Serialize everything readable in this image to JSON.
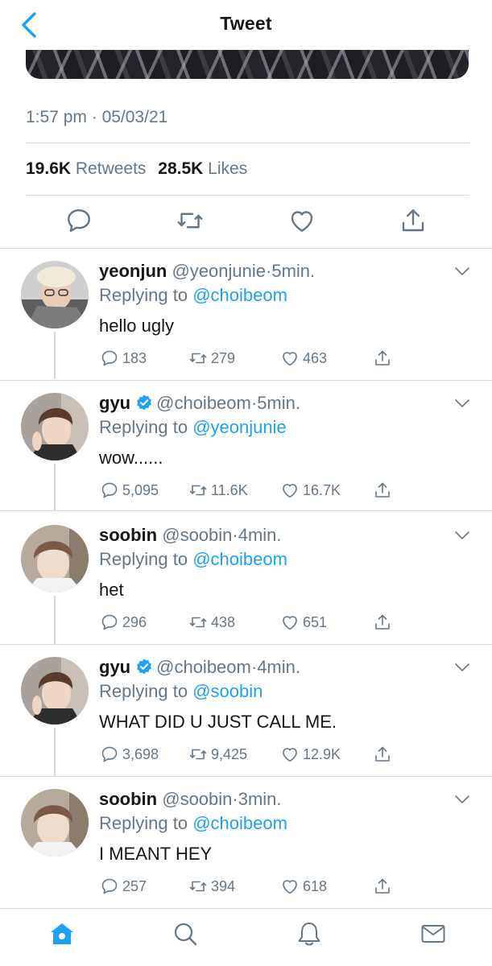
{
  "header": {
    "title": "Tweet"
  },
  "tweet": {
    "time": "1:57 pm",
    "date": "05/03/21",
    "retweets_count": "19.6K",
    "retweets_label": "Retweets",
    "likes_count": "28.5K",
    "likes_label": "Likes"
  },
  "colors": {
    "accent": "#1da1f2",
    "muted": "#657786",
    "text": "#14171a",
    "divider": "#d6dde2"
  },
  "replies": [
    {
      "name": "yeonjun",
      "handle": "@yeonjunie",
      "time": "5min.",
      "replying_prefix": "Replying to",
      "replying_to": "@choibeom",
      "text": "hello ugly",
      "replies": "183",
      "retweets": "279",
      "likes": "463",
      "verified": false
    },
    {
      "name": "gyu",
      "handle": "@choibeom",
      "time": "5min.",
      "replying_prefix": "Replying to",
      "replying_to": "@yeonjunie",
      "text": "wow......",
      "replies": "5,095",
      "retweets": "11.6K",
      "likes": "16.7K",
      "verified": true
    },
    {
      "name": "soobin",
      "handle": "@soobin",
      "time": "4min.",
      "replying_prefix": "Replying to",
      "replying_to": "@choibeom",
      "text": "het",
      "replies": "296",
      "retweets": "438",
      "likes": "651",
      "verified": false
    },
    {
      "name": "gyu",
      "handle": "@choibeom",
      "time": "4min.",
      "replying_prefix": "Replying to",
      "replying_to": "@soobin",
      "text": "WHAT DID U JUST CALL ME.",
      "replies": "3,698",
      "retweets": "9,425",
      "likes": "12.9K",
      "verified": true
    },
    {
      "name": "soobin",
      "handle": "@soobin",
      "time": "3min.",
      "replying_prefix": "Replying to",
      "replying_to": "@choibeom",
      "text": "I MEANT HEY",
      "replies": "257",
      "retweets": "394",
      "likes": "618",
      "verified": false
    }
  ],
  "icons": {
    "back": "chevron-left-icon",
    "reply": "reply-icon",
    "retweet": "retweet-icon",
    "like": "heart-icon",
    "share": "share-icon",
    "more": "chevron-down-icon",
    "verified": "verified-badge-icon",
    "tabs": [
      "home-icon",
      "search-icon",
      "bell-icon",
      "mail-icon"
    ]
  }
}
